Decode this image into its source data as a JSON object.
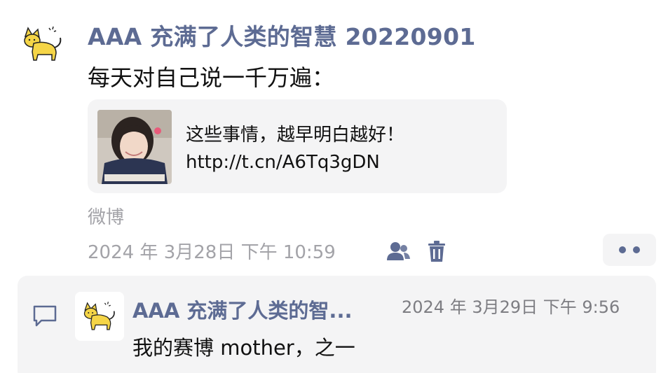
{
  "post": {
    "author": "AAA 充满了人类的智慧 20220901",
    "text": "每天对自己说一千万遍：",
    "link_card": {
      "title": "这些事情，越早明白越好！",
      "url": "http://t.cn/A6Tq3gDN"
    },
    "source": "微博",
    "time": "2024 年 3月28日 下午 10:59"
  },
  "icons": {
    "avatar": "cat-avatar-icon",
    "visibility": "person-icon",
    "delete": "trash-icon",
    "more": "more-dots-icon",
    "comment": "comment-bubble-icon"
  },
  "colors": {
    "name": "#5d6b93",
    "muted": "#a3a3a8",
    "card_bg": "#f4f4f5",
    "avatar_yellow": "#f5d547"
  },
  "comment": {
    "author": "AAA 充满了人类的智...",
    "time": "2024 年 3月29日 下午 9:56",
    "text": "我的赛博 mother，之一"
  }
}
